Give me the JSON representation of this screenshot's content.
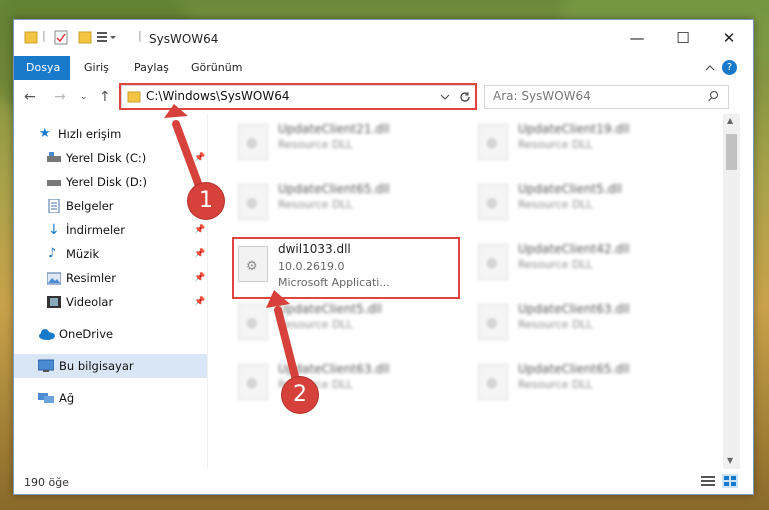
{
  "window": {
    "title": "SysWOW64",
    "minimize": "—",
    "maximize": "☐",
    "close": "✕"
  },
  "ribbon": {
    "tabs": [
      "Dosya",
      "Giriş",
      "Paylaş",
      "Görünüm"
    ],
    "help": "?"
  },
  "address": {
    "path": "C:\\Windows\\SysWOW64",
    "search_placeholder": "Ara: SysWOW64"
  },
  "sidebar": {
    "items": [
      {
        "label": "Hızlı erişim"
      },
      {
        "label": "Yerel Disk (C:)"
      },
      {
        "label": "Yerel Disk (D:)"
      },
      {
        "label": "Belgeler"
      },
      {
        "label": "İndirmeler"
      },
      {
        "label": "Müzik"
      },
      {
        "label": "Resimler"
      },
      {
        "label": "Videolar"
      },
      {
        "label": "OneDrive"
      },
      {
        "label": "Bu bilgisayar"
      },
      {
        "label": "Ağ"
      }
    ]
  },
  "files": {
    "blurred": [
      {
        "name": "UpdateClient21.dll",
        "type": "Resource DLL"
      },
      {
        "name": "UpdateClient19.dll",
        "type": "Resource DLL"
      },
      {
        "name": "UpdateClient65.dll",
        "type": "Resource DLL"
      },
      {
        "name": "UpdateClient5.dll",
        "type": "Resource DLL"
      },
      {
        "name": "UpdateClient42.dll",
        "type": "Resource DLL"
      },
      {
        "name": "UpdateClient5.dll",
        "type": "Resource DLL"
      },
      {
        "name": "UpdateClient63.dll",
        "type": "Resource DLL"
      },
      {
        "name": "UpdateClient63.dll",
        "type": "Resource DLL"
      },
      {
        "name": "UpdateClient65.dll",
        "type": "Resource DLL"
      }
    ],
    "highlighted": {
      "name": "dwil1033.dll",
      "version": "10.0.2619.0",
      "description": "Microsoft Applicati..."
    }
  },
  "status": {
    "count": "190 öğe"
  },
  "annotations": {
    "step1": "1",
    "step2": "2"
  },
  "colors": {
    "accent": "#1979ca",
    "highlight": "#e0443e"
  }
}
